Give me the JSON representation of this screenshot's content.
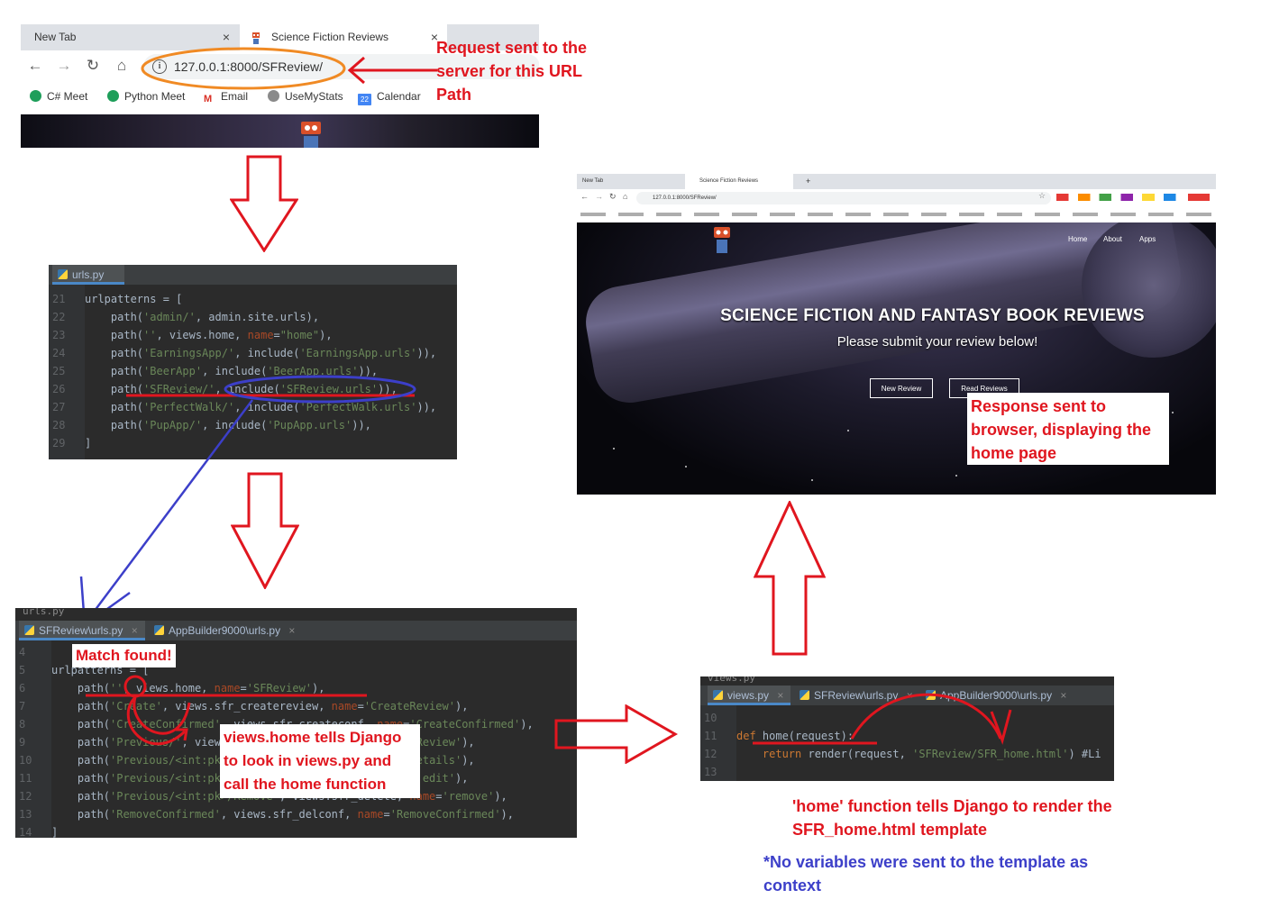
{
  "browser_top": {
    "tabs": [
      {
        "label": "New Tab",
        "close": "×"
      },
      {
        "label": "Science Fiction Reviews",
        "close": "×"
      }
    ],
    "url": "127.0.0.1:8000/SFReview/",
    "bookmarks": [
      "C# Meet",
      "Python Meet",
      "Email",
      "UseMyStats",
      "Calendar"
    ],
    "calendar_day": "22"
  },
  "annotations": {
    "request": "Request sent to the server for this URL Path",
    "match": "Match found!",
    "views_home": "views.home tells Django to look in views.py and call the home function",
    "response": "Response sent to browser, displaying the home page",
    "home_func": "'home' function tells Django to render the SFR_home.html template",
    "no_vars": "*No variables were sent to the template as context"
  },
  "code_urls": {
    "tab": "urls.py",
    "lines": [
      {
        "n": "21",
        "t": "urlpatterns = ["
      },
      {
        "n": "22",
        "t": "    path('admin/', admin.site.urls),"
      },
      {
        "n": "23",
        "t": "    path('', views.home, name=\"home\"),"
      },
      {
        "n": "24",
        "t": "    path('EarningsApp/', include('EarningsApp.urls')),"
      },
      {
        "n": "25",
        "t": "    path('BeerApp', include('BeerApp.urls')),"
      },
      {
        "n": "26",
        "t": "    path('SFReview/', include('SFReview.urls')),"
      },
      {
        "n": "27",
        "t": "    path('PerfectWalk/', include('PerfectWalk.urls')),"
      },
      {
        "n": "28",
        "t": "    path('PupApp/', include('PupApp.urls')),"
      },
      {
        "n": "29",
        "t": "]"
      }
    ]
  },
  "code_sfr": {
    "prev_tab": "urls.py",
    "tabs": [
      "SFReview\\urls.py",
      "AppBuilder9000\\urls.py"
    ],
    "lines": [
      {
        "n": "4",
        "t": ""
      },
      {
        "n": "5",
        "t": "urlpatterns = ["
      },
      {
        "n": "6",
        "t": "    path('', views.home, name='SFReview'),"
      },
      {
        "n": "7",
        "t": "    path('Create', views.sfr_createreview, name='CreateReview'),"
      },
      {
        "n": "8",
        "t": "    path('CreateConfirmed', views.sfr_createconf, name='CreateConfirmed'),"
      },
      {
        "n": "9",
        "t": "    path('Previous/', views.sfr_previous, name='PreviousReview'),"
      },
      {
        "n": "10",
        "t": "    path('Previous/<int:pk>', views.sfr_details, name='details'),"
      },
      {
        "n": "11",
        "t": "    path('Previous/<int:pk>/Edit', views.sfr_edit, name='edit'),"
      },
      {
        "n": "12",
        "t": "    path('Previous/<int:pk>/Remove', views.sfr_delete, name='remove'),"
      },
      {
        "n": "13",
        "t": "    path('RemoveConfirmed', views.sfr_delconf, name='RemoveConfirmed'),"
      },
      {
        "n": "14",
        "t": "]"
      }
    ]
  },
  "code_views": {
    "prev_tab": "views.py",
    "tabs": [
      "views.py",
      "SFReview\\urls.py",
      "AppBuilder9000\\urls.py"
    ],
    "lines": [
      {
        "n": "10",
        "t": ""
      },
      {
        "n": "11",
        "t": "def home(request):"
      },
      {
        "n": "12",
        "t": "    return render(request, 'SFReview/SFR_home.html') #Li"
      },
      {
        "n": "13",
        "t": ""
      }
    ]
  },
  "browser_result": {
    "tabs": [
      "New Tab",
      "Science Fiction Reviews"
    ],
    "url": "127.0.0.1:8000/SFReview/",
    "nav": [
      "Home",
      "About",
      "Apps"
    ],
    "title": "SCIENCE FICTION AND FANTASY BOOK REVIEWS",
    "subtitle": "Please submit your review below!",
    "buttons": [
      "New Review",
      "Read Reviews"
    ]
  },
  "colors": {
    "annotation_red": "#e0161f",
    "annotation_blue": "#3c3fc9",
    "url_highlight": "#f08a24",
    "ide_bg": "#2b2b2b"
  }
}
